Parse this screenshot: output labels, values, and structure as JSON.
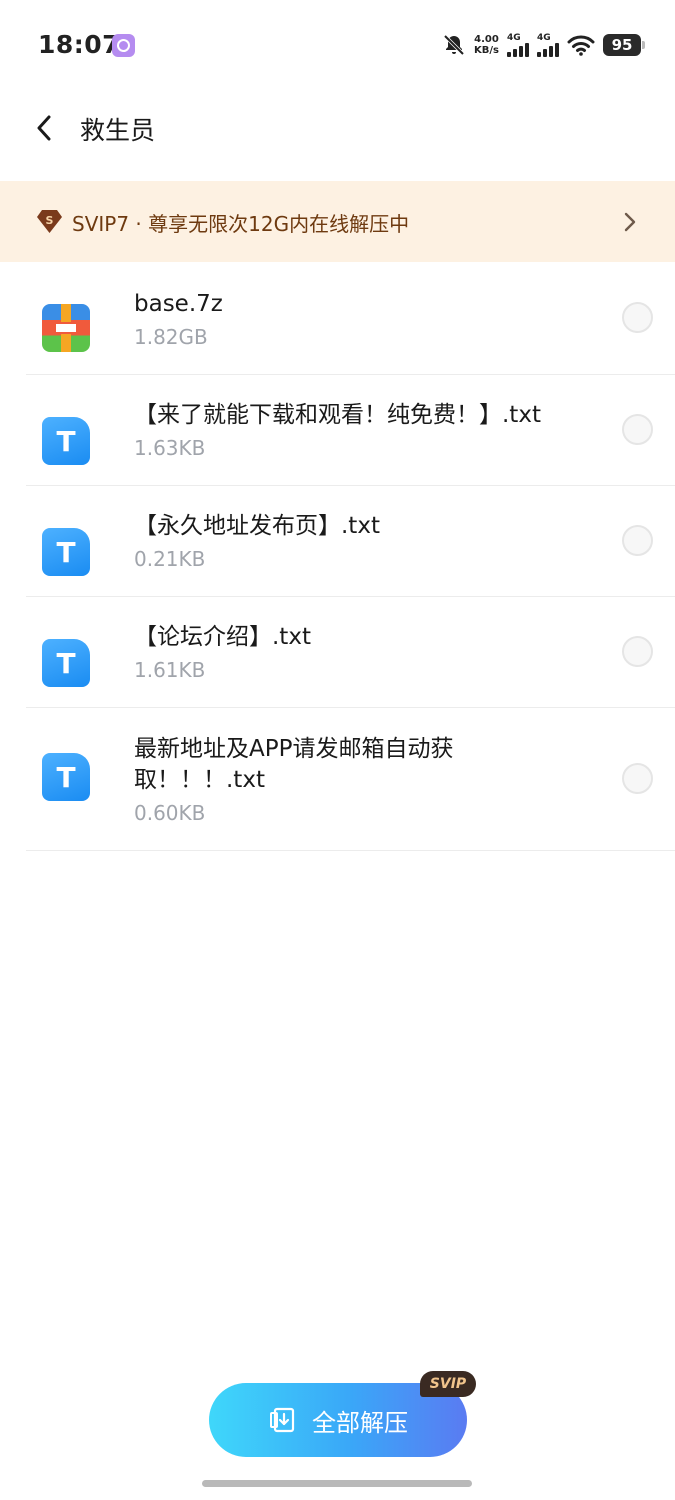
{
  "status_bar": {
    "time": "18:07",
    "net_speed_value": "4.00",
    "net_speed_unit": "KB/s",
    "signal_1": "4G",
    "signal_2": "4G",
    "battery": "95"
  },
  "header": {
    "title": "救生员"
  },
  "banner": {
    "text": "SVIP7 · 尊享无限次12G内在线解压中",
    "badge_letter": "S"
  },
  "files": [
    {
      "name": "base.7z",
      "size": "1.82GB",
      "icon": "archive-icon"
    },
    {
      "name": "【来了就能下载和观看！纯免费！】.txt",
      "size": "1.63KB",
      "icon": "txt-icon"
    },
    {
      "name": "【永久地址发布页】.txt",
      "size": "0.21KB",
      "icon": "txt-icon"
    },
    {
      "name": "【论坛介绍】.txt",
      "size": "1.61KB",
      "icon": "txt-icon"
    },
    {
      "name": "最新地址及APP请发邮箱自动获取！！！.txt",
      "size": "0.60KB",
      "icon": "txt-icon"
    }
  ],
  "txt_icon_letter": "T",
  "actions": {
    "extract_all_label": "全部解压",
    "svip_tag": "SVIP"
  },
  "colors": {
    "banner_bg": "#fdf1e2",
    "banner_text": "#6e3a10",
    "button_gradient_start": "#3fd7fa",
    "button_gradient_end": "#5a7bf2",
    "txt_icon": "#1a8cf2"
  }
}
